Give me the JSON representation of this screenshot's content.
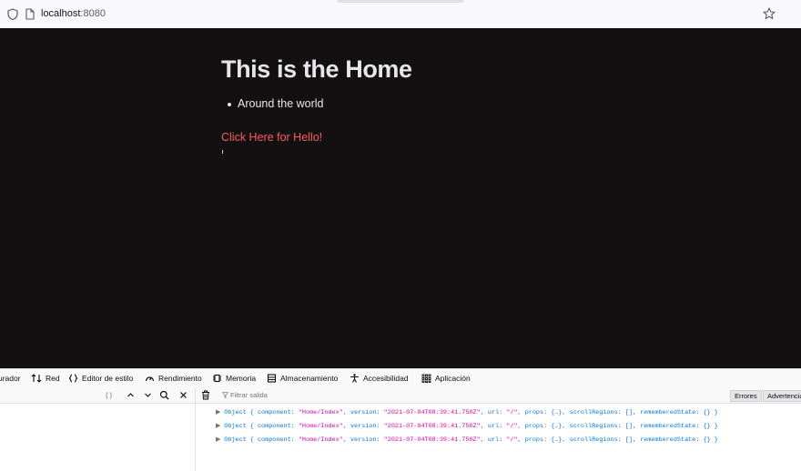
{
  "url": {
    "host": "localhost",
    "port": ":8080"
  },
  "page": {
    "title": "This is the Home",
    "list_items": [
      "Around the world"
    ],
    "link": "Click Here for Hello!"
  },
  "devtools": {
    "tabs": [
      "urador",
      "Red",
      "Editor de estilo",
      "Rendimiento",
      "Memoria",
      "Almacenamiento",
      "Accesibilidad",
      "Aplicación"
    ],
    "toolbar": {
      "braces": "{ }",
      "filter_placeholder": "Filtrar salida",
      "errors_label": "Errores",
      "warnings_label": "Advertencias"
    },
    "log": {
      "prefix": "Object { ",
      "component_key": "component: ",
      "component_val": "\"Home/Index\"",
      "version_key": ", version: ",
      "version_val": "\"2021-07-04T08:39:41.750Z\"",
      "url_key": ", url: ",
      "url_val": "\"/\"",
      "rest": ", props: {…}, scrollRegions: [], rememberedState: {} }"
    }
  },
  "colors": {
    "page_bg": "#121011",
    "link": "#ff5c5c",
    "log_blue": "#0074e8",
    "log_string": "#dd00a9"
  }
}
